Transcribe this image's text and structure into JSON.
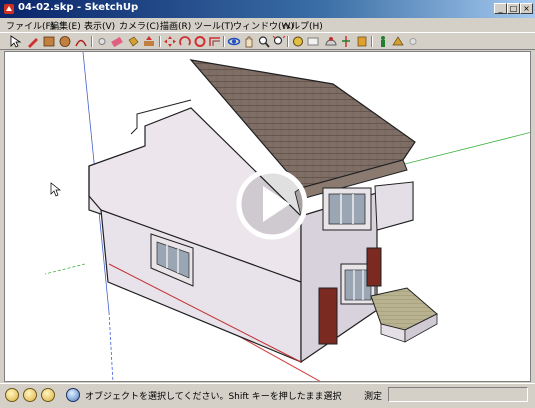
{
  "window": {
    "title": "04-02.skp - SketchUp",
    "controls": [
      "minimize",
      "maximize",
      "close"
    ]
  },
  "menubar": {
    "items": [
      "ファイル(F)",
      "編集(E)",
      "表示(V)",
      "カメラ(C)",
      "描画(R)",
      "ツール(T)",
      "ウィンドウ(W)",
      "ヘルプ(H)"
    ]
  },
  "toolbar": {
    "tools": [
      "select-tool",
      "line-tool",
      "rectangle-tool",
      "circle-tool",
      "arc-tool",
      "make-component-tool",
      "eraser-tool",
      "paint-bucket-tool",
      "push-pull-tool",
      "move-tool",
      "rotate-tool",
      "follow-me-tool",
      "offset-tool",
      "orbit-tool",
      "pan-tool",
      "zoom-tool",
      "zoom-extents-tool",
      "tape-measure-tool",
      "dimension-tool",
      "protractor-tool",
      "text-tool",
      "axes-tool",
      "3d-text-tool",
      "section-plane-tool",
      "walk-tool",
      "position-camera-tool"
    ]
  },
  "viewport": {
    "media_overlay": "play-button",
    "colors": {
      "axis_red": "#d04040",
      "axis_green": "#40b040",
      "axis_blue": "#4060d0",
      "roof": "#7a6a60",
      "walls": "#ece8ec"
    }
  },
  "status": {
    "icons": [
      "geo-location-icon",
      "credits-icon",
      "user-icon",
      "help-icon"
    ],
    "text": "オブジェクトを選択してください。Shift キーを押したまま選択",
    "measurements_label": "測定",
    "measurements_value": ""
  }
}
